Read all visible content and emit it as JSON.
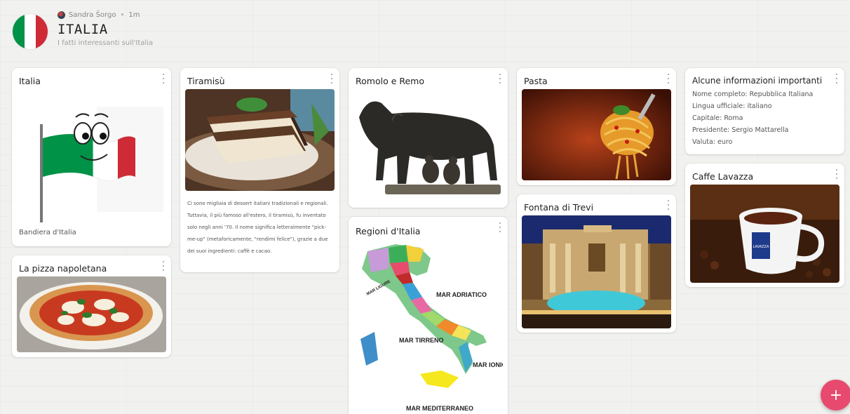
{
  "header": {
    "author": "Sandra Šorgo",
    "time": "1m",
    "title": "ITALIA",
    "subtitle": "I fatti interessanti sull'Italia"
  },
  "cards": {
    "italia": {
      "title": "Italia",
      "caption": "Bandiera d'Italia"
    },
    "pizza": {
      "title": "La pizza napoletana"
    },
    "tiramisu": {
      "title": "Tiramisù",
      "text": "Ci sono migliaia di dessert italiani tradizionali e regionali. Tuttavia, il più famoso all'estero, il tiramisù, fu inventato solo negli anni '70. Il nome significa letteralmente \"pick-me-up\" (metaforicamente, \"rendimi felice\"), grazie a due dei suoi ingredienti: caffè e cacao."
    },
    "romolo": {
      "title": "Romolo e Remo"
    },
    "regioni": {
      "title": "Regioni d'Italia",
      "labels": {
        "adriatico": "MAR ADRIATICO",
        "tirreno": "MAR TIRRENO",
        "ionio": "MAR IONIO",
        "mediterraneo": "MAR MEDITERRANEO",
        "ligure": "MAR LIGURE"
      }
    },
    "pasta": {
      "title": "Pasta"
    },
    "trevi": {
      "title": "Fontana di Trevi"
    },
    "info": {
      "title": "Alcune informazioni importanti",
      "lines": [
        "Nome completo: Repubblica Italiana",
        "Lingua ufficiale: italiano",
        "Capitale: Roma",
        "Presidente: Sergio Mattarella",
        "Valuta: euro"
      ]
    },
    "caffe": {
      "title": "Caffe Lavazza",
      "cup_brand": "LAVAZZA"
    }
  },
  "fab": {
    "label": "+"
  },
  "colors": {
    "flag_green": "#009246",
    "flag_white": "#ffffff",
    "flag_red": "#ce2b37",
    "fab": "#e84a6f"
  }
}
